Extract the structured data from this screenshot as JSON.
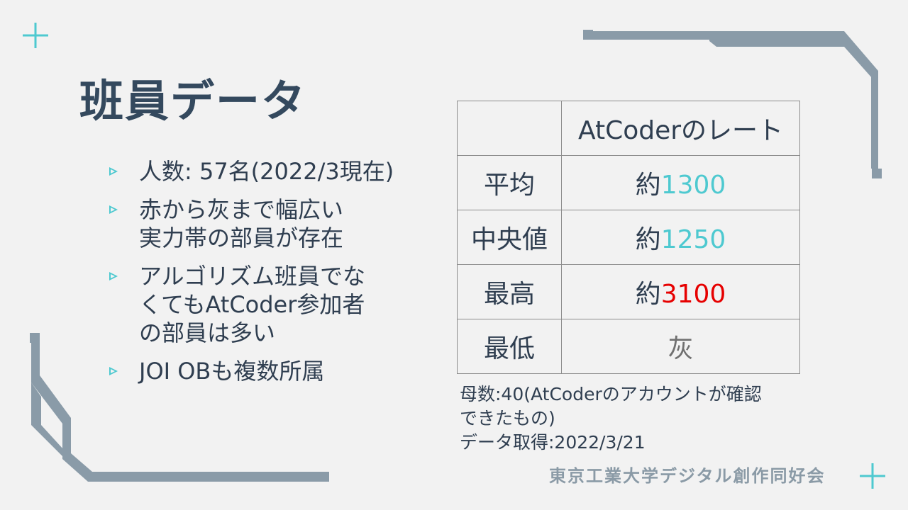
{
  "slide": {
    "title": "班員データ",
    "bullets": [
      {
        "text": "人数: 57名(2022/3現在)"
      },
      {
        "text": "赤から灰まで幅広い\n実力帯の部員が存在"
      },
      {
        "text": "アルゴリズム班員でな\nくてもAtCoder参加者\nの部員は多い"
      },
      {
        "text": "JOI OBも複数所属"
      }
    ],
    "table": {
      "header": "AtCoderのレート",
      "rows": [
        {
          "label": "平均",
          "prefix": "約",
          "value": "1300",
          "color": "cyan"
        },
        {
          "label": "中央値",
          "prefix": "約",
          "value": "1250",
          "color": "cyan"
        },
        {
          "label": "最高",
          "prefix": "約",
          "value": "3100",
          "color": "red"
        },
        {
          "label": "最低",
          "prefix": "",
          "value": "灰",
          "color": "gray"
        }
      ]
    },
    "note_lines": [
      "母数:40(AtCoderのアカウントが確認",
      "できたもの)",
      "データ取得:2022/3/21"
    ],
    "organization": "東京工業大学デジタル創作同好会"
  },
  "colors": {
    "accent_cyan": "#4ec9d0",
    "accent_red": "#e60000",
    "circuit_gray": "#8a9ba8",
    "text_dark": "#2f3e50",
    "background": "#f2f2f2"
  },
  "icons": [
    "plus-icon",
    "bullet-arrow-icon"
  ]
}
